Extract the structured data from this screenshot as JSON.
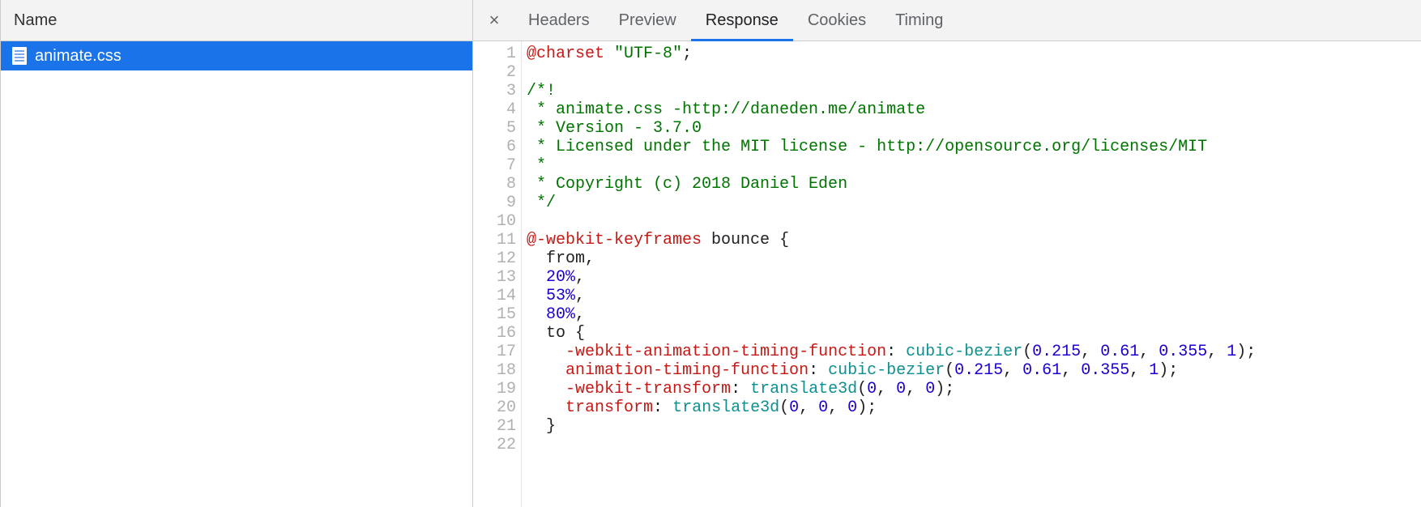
{
  "left": {
    "header_label": "Name",
    "files": [
      {
        "name": "animate.css"
      }
    ]
  },
  "right": {
    "tabs": {
      "headers": "Headers",
      "preview": "Preview",
      "response": "Response",
      "cookies": "Cookies",
      "timing": "Timing"
    },
    "active_tab": "response"
  },
  "code": {
    "line_numbers": [
      "1",
      "2",
      "3",
      "4",
      "5",
      "6",
      "7",
      "8",
      "9",
      "10",
      "11",
      "12",
      "13",
      "14",
      "15",
      "16",
      "17",
      "18",
      "19",
      "20",
      "21",
      "22"
    ],
    "lines": [
      [
        {
          "t": "@charset",
          "c": "tk-at"
        },
        {
          "t": " "
        },
        {
          "t": "\"UTF-8\"",
          "c": "tk-str"
        },
        {
          "t": ";"
        }
      ],
      [],
      [
        {
          "t": "/*!",
          "c": "tk-cmt"
        }
      ],
      [
        {
          "t": " * animate.css -http://daneden.me/animate",
          "c": "tk-cmt"
        }
      ],
      [
        {
          "t": " * Version - 3.7.0",
          "c": "tk-cmt"
        }
      ],
      [
        {
          "t": " * Licensed under the MIT license - http://opensource.org/licenses/MIT",
          "c": "tk-cmt"
        }
      ],
      [
        {
          "t": " *",
          "c": "tk-cmt"
        }
      ],
      [
        {
          "t": " * Copyright (c) 2018 Daniel Eden",
          "c": "tk-cmt"
        }
      ],
      [
        {
          "t": " */",
          "c": "tk-cmt"
        }
      ],
      [],
      [
        {
          "t": "@-webkit-keyframes",
          "c": "tk-at"
        },
        {
          "t": " bounce {"
        }
      ],
      [
        {
          "t": "  from,"
        }
      ],
      [
        {
          "t": "  "
        },
        {
          "t": "20%",
          "c": "tk-pct"
        },
        {
          "t": ","
        }
      ],
      [
        {
          "t": "  "
        },
        {
          "t": "53%",
          "c": "tk-pct"
        },
        {
          "t": ","
        }
      ],
      [
        {
          "t": "  "
        },
        {
          "t": "80%",
          "c": "tk-pct"
        },
        {
          "t": ","
        }
      ],
      [
        {
          "t": "  to {"
        }
      ],
      [
        {
          "t": "    "
        },
        {
          "t": "-webkit-animation-timing-function",
          "c": "tk-prop"
        },
        {
          "t": ": "
        },
        {
          "t": "cubic-bezier",
          "c": "tk-fn"
        },
        {
          "t": "("
        },
        {
          "t": "0.215",
          "c": "tk-num"
        },
        {
          "t": ", "
        },
        {
          "t": "0.61",
          "c": "tk-num"
        },
        {
          "t": ", "
        },
        {
          "t": "0.355",
          "c": "tk-num"
        },
        {
          "t": ", "
        },
        {
          "t": "1",
          "c": "tk-num"
        },
        {
          "t": ");"
        }
      ],
      [
        {
          "t": "    "
        },
        {
          "t": "animation-timing-function",
          "c": "tk-prop"
        },
        {
          "t": ": "
        },
        {
          "t": "cubic-bezier",
          "c": "tk-fn"
        },
        {
          "t": "("
        },
        {
          "t": "0.215",
          "c": "tk-num"
        },
        {
          "t": ", "
        },
        {
          "t": "0.61",
          "c": "tk-num"
        },
        {
          "t": ", "
        },
        {
          "t": "0.355",
          "c": "tk-num"
        },
        {
          "t": ", "
        },
        {
          "t": "1",
          "c": "tk-num"
        },
        {
          "t": ");"
        }
      ],
      [
        {
          "t": "    "
        },
        {
          "t": "-webkit-transform",
          "c": "tk-prop"
        },
        {
          "t": ": "
        },
        {
          "t": "translate3d",
          "c": "tk-fn"
        },
        {
          "t": "("
        },
        {
          "t": "0",
          "c": "tk-num"
        },
        {
          "t": ", "
        },
        {
          "t": "0",
          "c": "tk-num"
        },
        {
          "t": ", "
        },
        {
          "t": "0",
          "c": "tk-num"
        },
        {
          "t": ");"
        }
      ],
      [
        {
          "t": "    "
        },
        {
          "t": "transform",
          "c": "tk-prop"
        },
        {
          "t": ": "
        },
        {
          "t": "translate3d",
          "c": "tk-fn"
        },
        {
          "t": "("
        },
        {
          "t": "0",
          "c": "tk-num"
        },
        {
          "t": ", "
        },
        {
          "t": "0",
          "c": "tk-num"
        },
        {
          "t": ", "
        },
        {
          "t": "0",
          "c": "tk-num"
        },
        {
          "t": ");"
        }
      ],
      [
        {
          "t": "  }"
        }
      ],
      []
    ]
  }
}
